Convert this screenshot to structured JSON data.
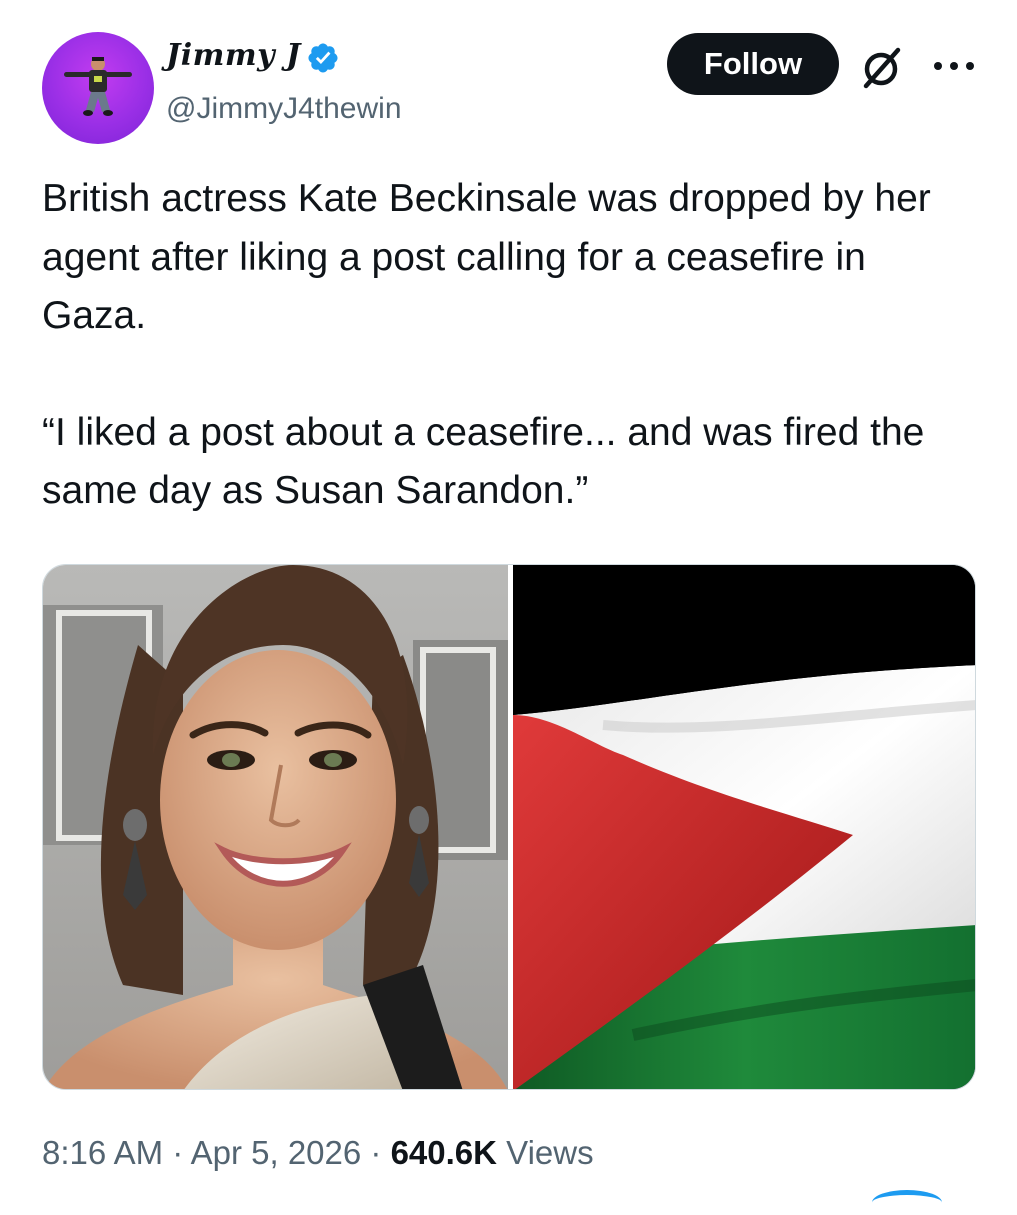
{
  "author": {
    "display_name": "Jimmy J",
    "handle": "@JimmyJ4thewin",
    "verified": true,
    "avatar_icon": "profile-photo-icon",
    "avatar_color": "#a333ea"
  },
  "actions": {
    "follow_label": "Follow",
    "grok_icon": "grok-icon",
    "more_icon": "more-dots-icon"
  },
  "tweet": {
    "paragraph1": "British actress Kate Beckinsale was dropped by her agent after liking a post calling for a ceasefire in Gaza.",
    "paragraph2": "“I liked a post about a ceasefire... and was fired the same day as Susan Sarandon.”"
  },
  "media": {
    "left_image": "woman-portrait-photo",
    "right_image": "palestinian-flag-photo",
    "flag_colors": [
      "#d32f2f",
      "#000000",
      "#ffffff",
      "#1f8a3b"
    ]
  },
  "meta": {
    "time": "8:16 AM",
    "separator": "·",
    "date": "Apr 5, 2026",
    "views_count": "640.6K",
    "views_label": "Views"
  },
  "colors": {
    "text": "#0f1419",
    "secondary": "#536471",
    "verified_blue": "#1d9bf0",
    "button_bg": "#0f1419"
  }
}
